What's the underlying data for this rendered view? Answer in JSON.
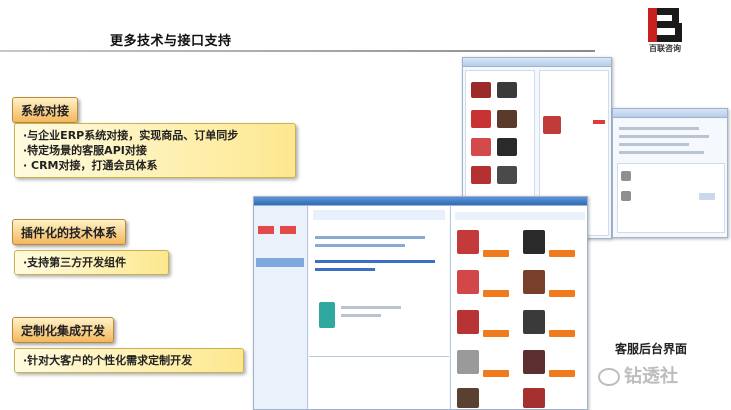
{
  "header": {
    "title": "更多技术与接口支持",
    "logo_text": "百联咨询"
  },
  "sections": [
    {
      "label": "系统对接",
      "lines": [
        "·与企业ERP系统对接，实现商品、订单同步",
        "·特定场景的客服API对接",
        "· CRM对接，打通会员体系"
      ]
    },
    {
      "label": "插件化的技术体系",
      "lines": [
        "·支持第三方开发组件"
      ]
    },
    {
      "label": "定制化集成开发",
      "lines": [
        "·针对大客户的个性化需求定制开发"
      ]
    }
  ],
  "caption": "客服后台界面",
  "watermark": "钻透社",
  "colors": {
    "label_gradient_top": "#fff2c8",
    "label_gradient_bottom": "#f3b75d",
    "desc_gradient": "#fde88f",
    "accent_orange": "#f07a1c",
    "price_red": "#e03b3b"
  }
}
